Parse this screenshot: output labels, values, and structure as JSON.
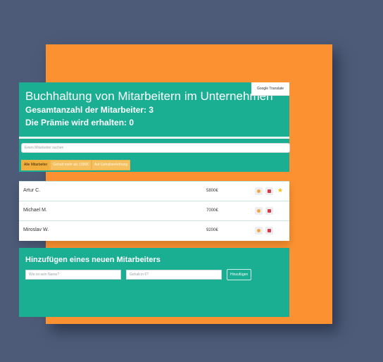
{
  "header": {
    "title": "Buchhaltung von Mitarbeitern im Unternehmen",
    "total": "Gesamtanzahl der Mitarbeiter: 3",
    "bonus": "Die Prämie wird erhalten: 0",
    "translate_badge": "Google Translate"
  },
  "search": {
    "placeholder": "Einen Mitarbeiter suchen"
  },
  "filters": [
    {
      "label": "Alle Mitarbeiter",
      "active": true
    },
    {
      "label": "Gehalt mehr als 1000€",
      "active": false
    },
    {
      "label": "Auf Gehaltserhöhung",
      "active": false
    }
  ],
  "employees": [
    {
      "name": "Artur C.",
      "salary": "5800€",
      "starred": true
    },
    {
      "name": "Michael M.",
      "salary": "7000€",
      "starred": false
    },
    {
      "name": "Miroslav W.",
      "salary": "9200€",
      "starred": false
    }
  ],
  "add_form": {
    "title": "Hinzufügen eines neuen Mitarbeiters",
    "name_placeholder": "Wie ist sein Name?",
    "salary_placeholder": "Gehalt in €?",
    "submit_label": "Hinzufügen"
  },
  "icons": {
    "row_actions": [
      "cookie-icon",
      "trash-icon"
    ],
    "favorite": "star-icon"
  },
  "colors": {
    "page_bg": "#4d5b78",
    "accent": "#fb9131",
    "app_teal": "#1aaf93",
    "filter_button": "#f4c060",
    "delete": "#d83a4a",
    "star": "#f2c400"
  }
}
